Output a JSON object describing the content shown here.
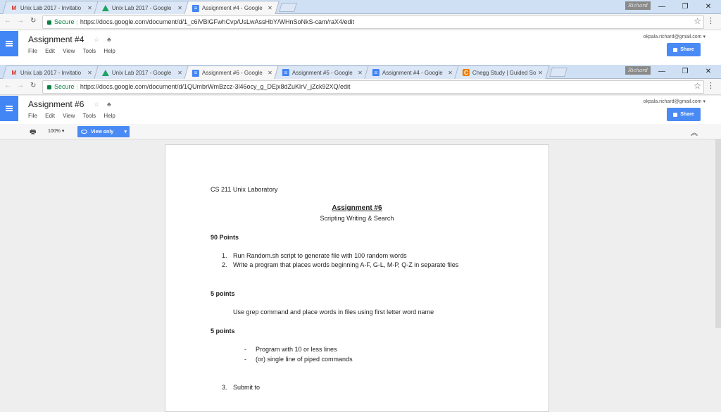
{
  "window1": {
    "tabs": [
      {
        "title": "Unix Lab 2017 - Invitatio",
        "icon": "gmail-icon"
      },
      {
        "title": "Unix Lab 2017 - Google",
        "icon": "drive-icon"
      },
      {
        "title": "Assignment #4 - Google",
        "icon": "docs-icon",
        "active": true
      }
    ],
    "user_badge": "Richard",
    "secure_label": "Secure",
    "url": "https://docs.google.com/document/d/1_c6iVBlGFwhCvp/UsLwAssHbY/WHnSoNkS-cam/raX4/edit",
    "doc_title": "Assignment #4",
    "menu": [
      "File",
      "Edit",
      "View",
      "Tools",
      "Help"
    ],
    "account": "okpala.richard@gmail.com",
    "share": "Share"
  },
  "window2": {
    "tabs": [
      {
        "title": "Unix Lab 2017 - Invitatio",
        "icon": "gmail-icon"
      },
      {
        "title": "Unix Lab 2017 - Google",
        "icon": "drive-icon"
      },
      {
        "title": "Assignment #6 - Google",
        "icon": "docs-icon",
        "active": true
      },
      {
        "title": "Assignment #5 - Google",
        "icon": "docs-icon"
      },
      {
        "title": "Assignment #4 - Google",
        "icon": "docs-icon"
      },
      {
        "title": "Chegg Study | Guided So",
        "icon": "chegg-icon"
      }
    ],
    "user_badge": "Richard",
    "secure_label": "Secure",
    "url": "https://docs.google.com/document/d/1QUmbrWmBzcz-3l46ocy_g_DEjx8dZuKlrV_jZck92XQ/edit",
    "doc_title": "Assignment #6",
    "menu": [
      "File",
      "Edit",
      "View",
      "Tools",
      "Help"
    ],
    "account": "okpala.richard@gmail.com",
    "share": "Share",
    "zoom": "100%",
    "view_only": "View only"
  },
  "document": {
    "course": "CS 211  Unix Laboratory",
    "heading": "Assignment #6",
    "subheading": "Scripting Writing & Search",
    "section1_points": "90 Points",
    "item1_num": "1.",
    "item1": "Run Random.sh script to generate file with 100 random words",
    "item2_num": "2.",
    "item2": "Write a program that places words beginning  A-F, G-L, M-P, Q-Z in separate files",
    "section2_points": "5 points",
    "section2_text": "Use grep command and place words in files using first letter word name",
    "section3_points": "5 points",
    "bullet1": "Program with 10 or less lines",
    "bullet2": "(or) single line of piped commands",
    "item3_num": "3.",
    "item3": "Submit  to"
  }
}
